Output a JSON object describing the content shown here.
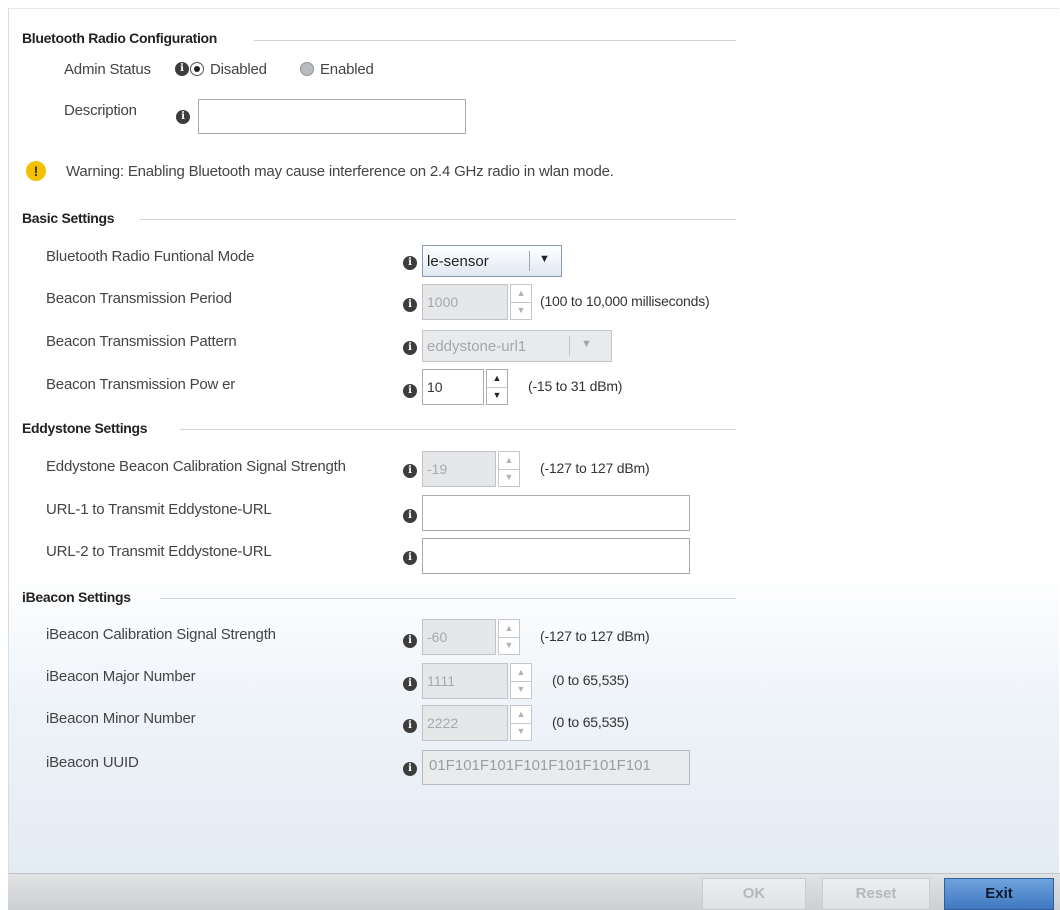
{
  "sections": {
    "bluetooth_radio": "Bluetooth Radio Configuration",
    "basic": "Basic Settings",
    "eddystone": "Eddystone Settings",
    "ibeacon": "iBeacon Settings"
  },
  "admin_status": {
    "label": "Admin Status",
    "option_disabled": "Disabled",
    "option_enabled": "Enabled",
    "selected": "Disabled"
  },
  "description": {
    "label": "Description",
    "value": ""
  },
  "warning": {
    "text": "Warning: Enabling Bluetooth may cause interference on 2.4 GHz radio in wlan mode."
  },
  "basic": {
    "functional_mode": {
      "label": "Bluetooth Radio Funtional Mode",
      "value": "le-sensor"
    },
    "tx_period": {
      "label": "Beacon Transmission Period",
      "value": "1000",
      "hint": "(100 to 10,000 milliseconds)"
    },
    "tx_pattern": {
      "label": "Beacon Transmission Pattern",
      "value": "eddystone-url1"
    },
    "tx_power": {
      "label": "Beacon Transmission Pow er",
      "value": "10",
      "hint": "(-15 to 31 dBm)"
    }
  },
  "eddystone": {
    "calibration": {
      "label": "Eddystone Beacon Calibration Signal Strength",
      "value": "-19",
      "hint": "(-127 to 127 dBm)"
    },
    "url1": {
      "label": "URL-1 to Transmit Eddystone-URL",
      "value": ""
    },
    "url2": {
      "label": "URL-2 to Transmit Eddystone-URL",
      "value": ""
    }
  },
  "ibeacon": {
    "calibration": {
      "label": "iBeacon Calibration Signal Strength",
      "value": "-60",
      "hint": "(-127 to 127 dBm)"
    },
    "major": {
      "label": "iBeacon Major Number",
      "value": "1111",
      "hint": "(0 to 65,535)"
    },
    "minor": {
      "label": "iBeacon Minor Number",
      "value": "2222",
      "hint": "(0 to 65,535)"
    },
    "uuid": {
      "label": "iBeacon UUID",
      "value": "01F101F101F101F101F101F101"
    }
  },
  "footer": {
    "ok": "OK",
    "reset": "Reset",
    "exit": "Exit"
  },
  "icons": {
    "info": "info-icon",
    "warning": "warning-icon"
  },
  "colors": {
    "primary_button": "#3f78c0",
    "warning": "#f2c200"
  }
}
